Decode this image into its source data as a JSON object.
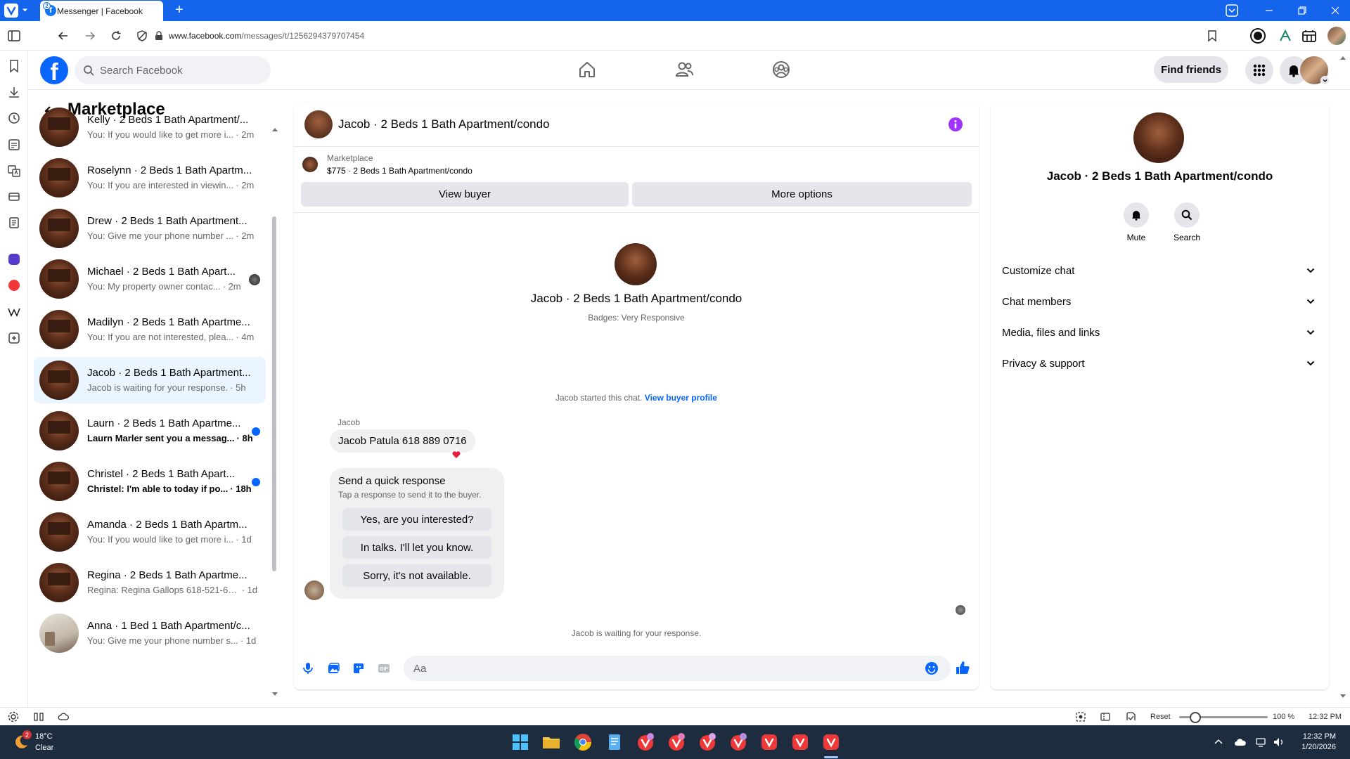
{
  "browser": {
    "tab_title": "Messenger | Facebook",
    "tab_badge": "2",
    "url_domain": "www.facebook.com",
    "url_path": "/messages/t/1256294379707454"
  },
  "facebook": {
    "search_placeholder": "Search Facebook",
    "find_friends_label": "Find friends"
  },
  "sidebar": {
    "title": "Marketplace",
    "conversations": [
      {
        "name": "Kelly · 2 Beds 1 Bath Apartment/...",
        "snippet": "You: If you would like to get more i...",
        "time": "· 2m",
        "thumb": "dark",
        "selected": false,
        "unread": false
      },
      {
        "name": "Roselynn · 2 Beds 1 Bath Apartm...",
        "snippet": "You: If you are interested in viewin...",
        "time": "· 2m",
        "thumb": "dark",
        "selected": false,
        "unread": false
      },
      {
        "name": "Drew · 2 Beds 1 Bath Apartment...",
        "snippet": "You: Give me your phone number ...",
        "time": "· 2m",
        "thumb": "dark",
        "selected": false,
        "unread": false
      },
      {
        "name": "Michael · 2 Beds 1 Bath Apart...",
        "snippet": "You: My property owner contac...",
        "time": "· 2m",
        "thumb": "dark",
        "selected": false,
        "unread": false,
        "seen": true
      },
      {
        "name": "Madilyn · 2 Beds 1 Bath Apartme...",
        "snippet": "You: If you are not interested, plea...",
        "time": "· 4m",
        "thumb": "dark",
        "selected": false,
        "unread": false
      },
      {
        "name": "Jacob · 2 Beds 1 Bath Apartment...",
        "snippet": "Jacob is waiting for your response.",
        "time": "· 5h",
        "thumb": "dark",
        "selected": true,
        "unread": false
      },
      {
        "name": "Laurn · 2 Beds 1 Bath Apartme...",
        "snippet": "Laurn Marler sent you a messag...",
        "time": "· 8h",
        "thumb": "dark",
        "selected": false,
        "unread": true
      },
      {
        "name": "Christel · 2 Beds 1 Bath Apart...",
        "snippet": "Christel: I'm able to today if po...",
        "time": "· 18h",
        "thumb": "dark",
        "selected": false,
        "unread": true
      },
      {
        "name": "Amanda · 2 Beds 1 Bath Apartm...",
        "snippet": "You: If you would like to get more i...",
        "time": "· 1d",
        "thumb": "dark",
        "selected": false,
        "unread": false
      },
      {
        "name": "Regina · 2 Beds 1 Bath Apartme...",
        "snippet": "Regina: Regina Gallops 618-521-62...",
        "time": "· 1d",
        "thumb": "dark",
        "selected": false,
        "unread": false
      },
      {
        "name": "Anna · 1 Bed 1 Bath Apartment/c...",
        "snippet": "You: Give me your phone number s...",
        "time": "· 1d",
        "thumb": "light",
        "selected": false,
        "unread": false
      }
    ]
  },
  "chat": {
    "title": "Jacob · 2 Beds 1 Bath Apartment/condo",
    "marketplace_label": "Marketplace",
    "listing": "$775 · 2 Beds 1 Bath Apartment/condo",
    "view_buyer_label": "View buyer",
    "more_options_label": "More options",
    "hero_name": "Jacob · 2 Beds 1 Bath Apartment/condo",
    "badges": "Badges: Very Responsive",
    "started_text": "Jacob started this chat.",
    "view_buyer_profile": "View buyer profile",
    "sender": "Jacob",
    "message": "Jacob Patula 618 889 0716",
    "quick_title": "Send a quick response",
    "quick_sub": "Tap a response to send it to the buyer.",
    "quick_replies": [
      "Yes, are you interested?",
      "In talks. I'll let you know.",
      "Sorry, it's not available."
    ],
    "waiting": "Jacob is waiting for your response.",
    "composer_placeholder": "Aa"
  },
  "info": {
    "name": "Jacob · 2 Beds 1 Bath Apartment/condo",
    "mute_label": "Mute",
    "search_label": "Search",
    "sections": [
      "Customize chat",
      "Chat members",
      "Media, files and links",
      "Privacy & support"
    ]
  },
  "statusbar": {
    "reset_label": "Reset",
    "zoom": "100 %",
    "zoom_level": 1.0,
    "time": "12:32 PM"
  },
  "taskbar": {
    "weather_badge": "2",
    "temperature": "18°C",
    "condition": "Clear",
    "time": "12:32 PM",
    "date": "1/20/2026"
  },
  "colors": {
    "browser_blue": "#1464ec",
    "facebook_blue": "#0866ff",
    "selected_row": "#ebf5ff",
    "info_purple": "#a033ff",
    "taskbar": "#1e2c3f"
  }
}
